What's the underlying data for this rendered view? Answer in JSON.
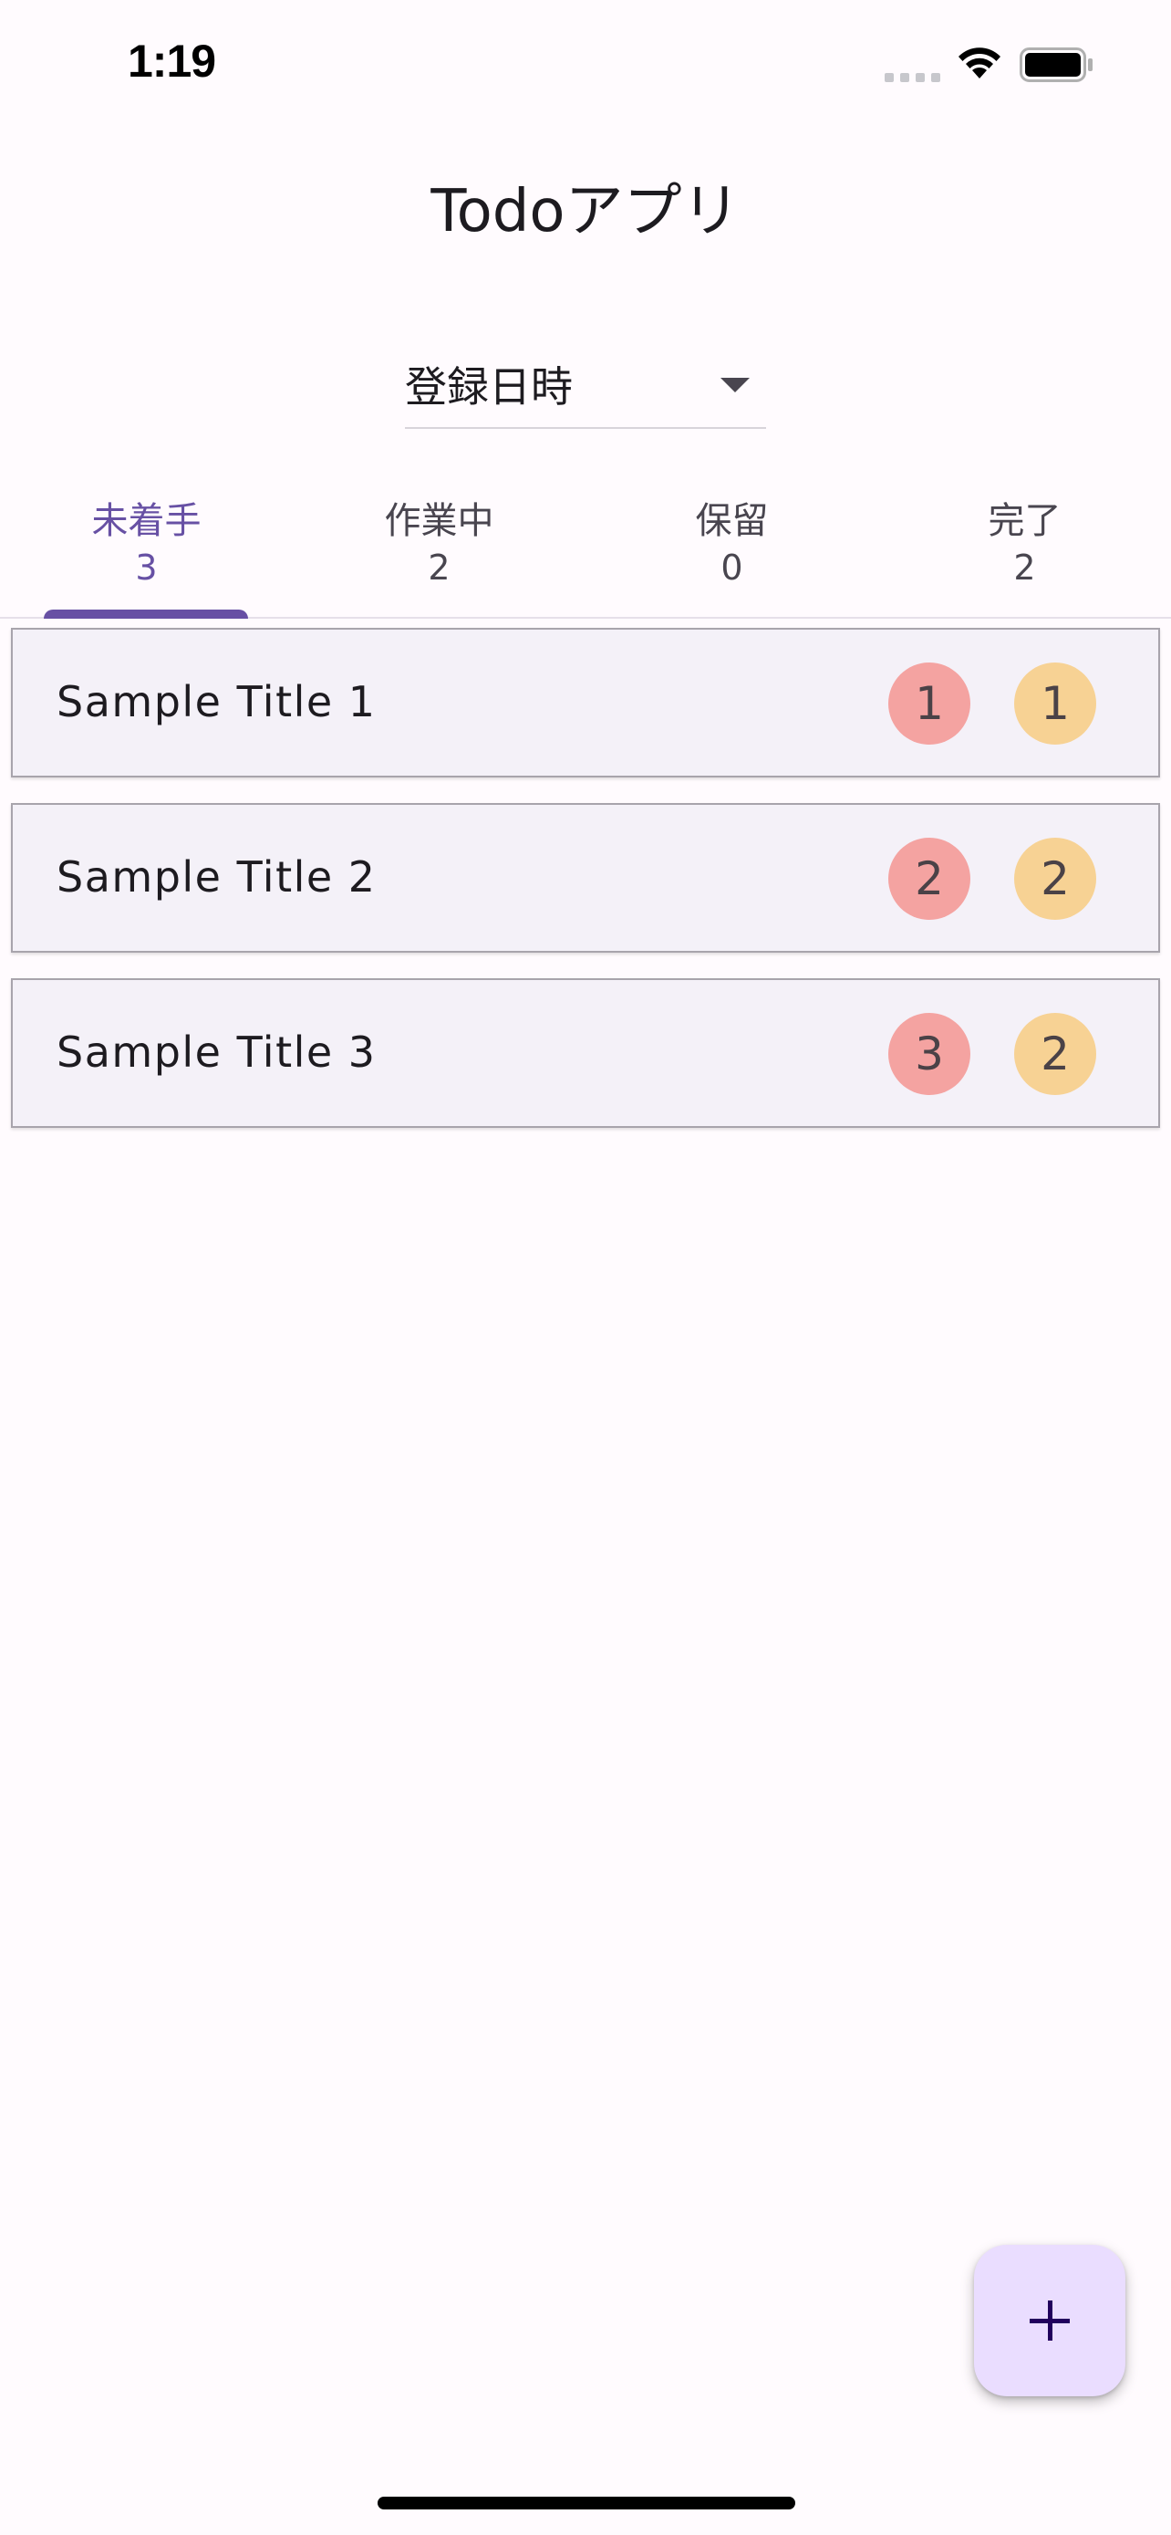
{
  "status_bar": {
    "time": "1:19"
  },
  "app_bar": {
    "title": "Todoアプリ"
  },
  "sort": {
    "selected": "登録日時"
  },
  "tabs": [
    {
      "label": "未着手",
      "count": "3",
      "active": true
    },
    {
      "label": "作業中",
      "count": "2",
      "active": false
    },
    {
      "label": "保留",
      "count": "0",
      "active": false
    },
    {
      "label": "完了",
      "count": "2",
      "active": false
    }
  ],
  "todos": [
    {
      "title": "Sample Title 1",
      "badge_red": "1",
      "badge_orange": "1"
    },
    {
      "title": "Sample Title 2",
      "badge_red": "2",
      "badge_orange": "2"
    },
    {
      "title": "Sample Title 3",
      "badge_red": "3",
      "badge_orange": "2"
    }
  ],
  "colors": {
    "accent": "#6750a4",
    "badge_red": "#f4a3a1",
    "badge_orange": "#f7d294",
    "fab_bg": "#eaddff"
  },
  "fab": {
    "icon": "plus-icon"
  }
}
